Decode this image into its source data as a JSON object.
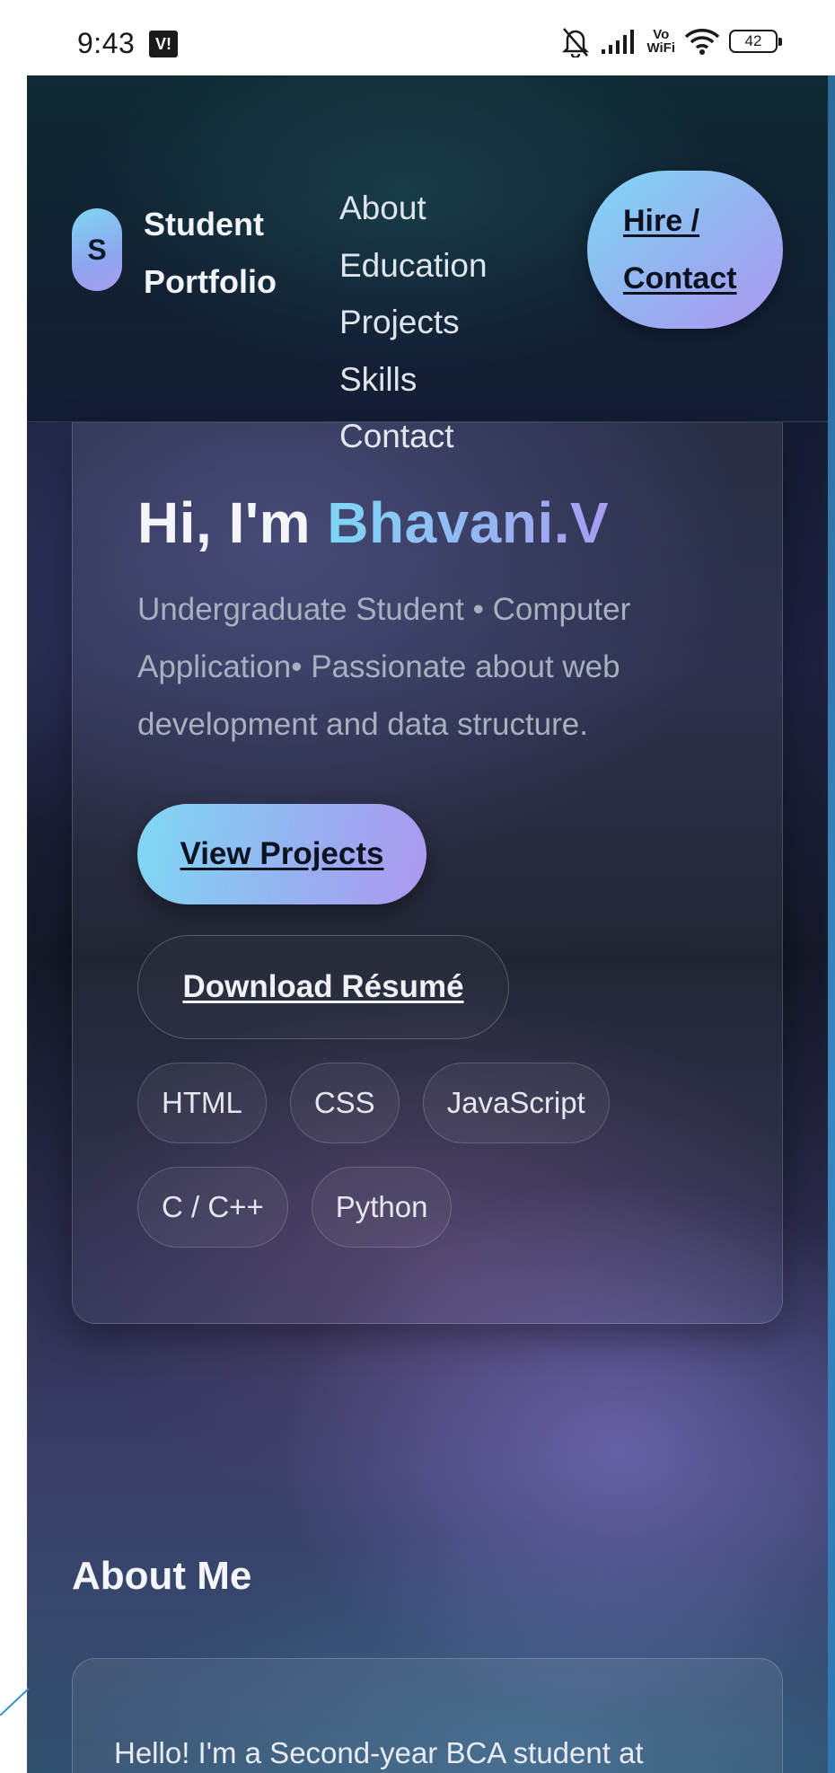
{
  "status_bar": {
    "time": "9:43",
    "app_badge": "V!",
    "vo_wifi_line1": "Vo",
    "vo_wifi_line2": "WiFi",
    "battery": "42"
  },
  "header": {
    "logo_letter": "S",
    "brand_line1": "Student",
    "brand_line2": "Portfolio",
    "nav": [
      {
        "label": "About"
      },
      {
        "label": "Education"
      },
      {
        "label": "Projects"
      },
      {
        "label": "Skills"
      },
      {
        "label": "Contact"
      }
    ],
    "cta_line1": "Hire /",
    "cta_line2": "Contact"
  },
  "hero": {
    "greeting": "Hi, I'm ",
    "name": "Bhavani.V",
    "description": "Undergraduate Student • Computer Application• Passionate about web development and data structure.",
    "primary_button": "View Projects",
    "secondary_button": "Download Résumé",
    "skills": [
      {
        "label": "HTML"
      },
      {
        "label": "CSS"
      },
      {
        "label": "JavaScript"
      },
      {
        "label": "C / C++"
      },
      {
        "label": "Python"
      }
    ]
  },
  "about": {
    "title": "About Me",
    "text": "Hello! I'm a Second-year BCA student at"
  },
  "colors": {
    "accent_start": "#7fd6f4",
    "accent_end": "#a99cf1",
    "background_dark": "#141a33"
  }
}
